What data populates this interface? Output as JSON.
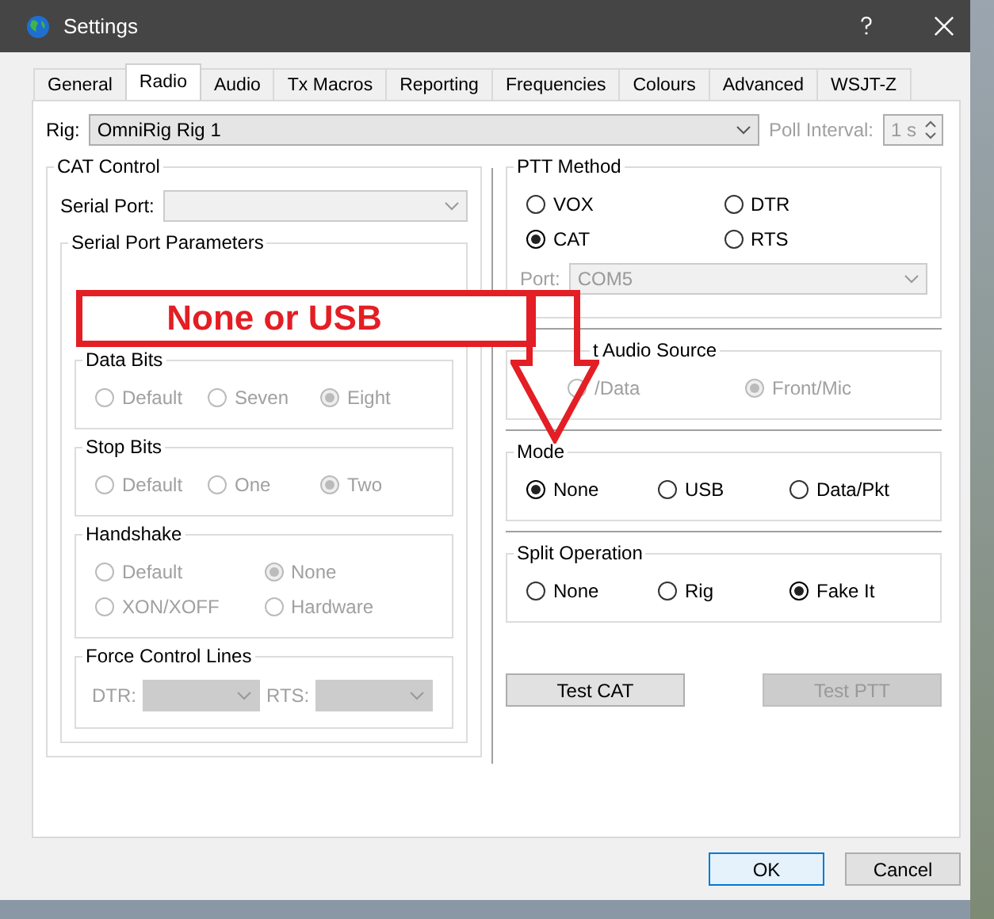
{
  "window": {
    "title": "Settings"
  },
  "tabs": [
    {
      "label": "General",
      "selected": false
    },
    {
      "label": "Radio",
      "selected": true
    },
    {
      "label": "Audio",
      "selected": false
    },
    {
      "label": "Tx Macros",
      "selected": false
    },
    {
      "label": "Reporting",
      "selected": false
    },
    {
      "label": "Frequencies",
      "selected": false
    },
    {
      "label": "Colours",
      "selected": false
    },
    {
      "label": "Advanced",
      "selected": false
    },
    {
      "label": "WSJT-Z",
      "selected": false
    }
  ],
  "rig": {
    "label": "Rig:",
    "value": "OmniRig Rig 1"
  },
  "poll_interval": {
    "label": "Poll Interval:",
    "value": "1 s",
    "disabled": true
  },
  "cat_control": {
    "title": "CAT Control",
    "serial_port": {
      "label": "Serial Port:",
      "disabled": true
    },
    "serial_port_parameters": {
      "title": "Serial Port Parameters",
      "groups": [
        {
          "title": "Data Bits",
          "disabled": true,
          "options": [
            {
              "label": "Default",
              "selected": false
            },
            {
              "label": "Seven",
              "selected": false
            },
            {
              "label": "Eight",
              "selected": true
            }
          ]
        },
        {
          "title": "Stop Bits",
          "disabled": true,
          "options": [
            {
              "label": "Default",
              "selected": false
            },
            {
              "label": "One",
              "selected": false
            },
            {
              "label": "Two",
              "selected": true
            }
          ]
        },
        {
          "title": "Handshake",
          "disabled": true,
          "options": [
            {
              "label": "Default",
              "selected": false
            },
            {
              "label": "None",
              "selected": true
            },
            {
              "label": "XON/XOFF",
              "selected": false
            },
            {
              "label": "Hardware",
              "selected": false
            }
          ]
        }
      ],
      "force_control_lines": {
        "title": "Force Control Lines",
        "disabled": true,
        "fields": [
          {
            "label": "DTR:"
          },
          {
            "label": "RTS:"
          }
        ]
      }
    }
  },
  "ptt_method": {
    "title": "PTT Method",
    "options": [
      {
        "label": "VOX",
        "selected": false
      },
      {
        "label": "DTR",
        "selected": false
      },
      {
        "label": "CAT",
        "selected": true
      },
      {
        "label": "RTS",
        "selected": false
      }
    ],
    "port": {
      "label": "Port:",
      "value": "COM5",
      "disabled": true
    }
  },
  "audio_source": {
    "title": "t Audio Source",
    "disabled": true,
    "options": [
      {
        "label": "/Data",
        "selected": false
      },
      {
        "label": "Front/Mic",
        "selected": true
      }
    ]
  },
  "mode": {
    "title": "Mode",
    "options": [
      {
        "label": "None",
        "selected": true
      },
      {
        "label": "USB",
        "selected": false
      },
      {
        "label": "Data/Pkt",
        "selected": false
      }
    ]
  },
  "split_operation": {
    "title": "Split Operation",
    "options": [
      {
        "label": "None",
        "selected": false
      },
      {
        "label": "Rig",
        "selected": false
      },
      {
        "label": "Fake It",
        "selected": true
      }
    ]
  },
  "test_buttons": [
    {
      "label": "Test CAT",
      "disabled": false
    },
    {
      "label": "Test PTT",
      "disabled": true
    }
  ],
  "dialog_buttons": [
    {
      "label": "OK",
      "default": true
    },
    {
      "label": "Cancel",
      "default": false
    }
  ],
  "annotation": {
    "text": "None or USB"
  }
}
